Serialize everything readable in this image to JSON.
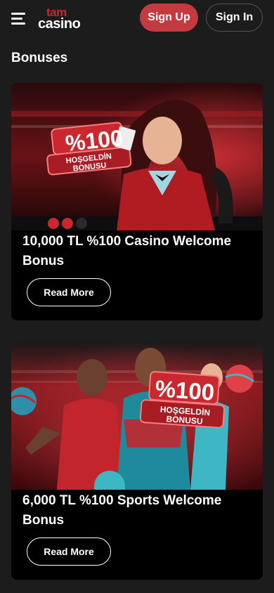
{
  "header": {
    "logo_top": "tam",
    "logo_bottom": "casino",
    "signup_label": "Sign Up",
    "signin_label": "Sign In"
  },
  "page": {
    "title": "Bonuses"
  },
  "bonuses": [
    {
      "title": "10,000 TL %100 Casino Welcome Bonus",
      "badge_percent": "%100",
      "badge_line1": "HOŞGELDİN",
      "badge_line2": "BONUSU",
      "button_label": "Read More"
    },
    {
      "title": "6,000 TL %100 Sports Welcome Bonus",
      "badge_percent": "%100",
      "badge_line1": "HOŞGELDİN",
      "badge_line2": "BONUSU",
      "button_label": "Read More"
    }
  ],
  "colors": {
    "accent": "#c43a3e",
    "background": "#1c1c1c",
    "card": "#000000"
  }
}
